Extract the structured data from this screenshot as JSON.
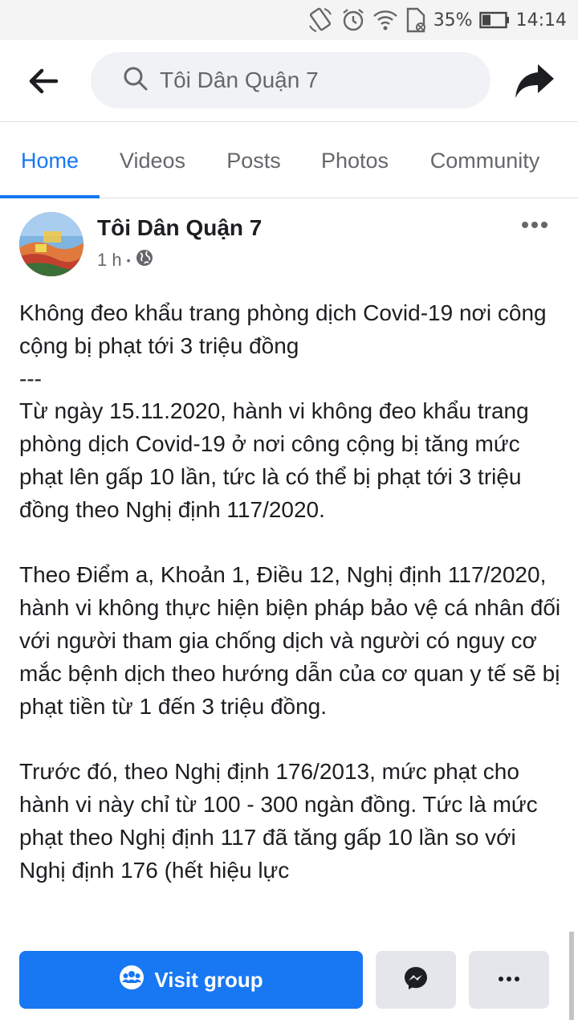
{
  "status_bar": {
    "battery": "35%",
    "time": "14:14",
    "icons": [
      "rotate-icon",
      "alarm-icon",
      "wifi-icon",
      "sim-icon",
      "battery-icon"
    ]
  },
  "nav": {
    "search_text": "Tôi Dân Quận 7",
    "icons": [
      "back-arrow-icon",
      "search-icon",
      "share-icon"
    ]
  },
  "tabs": [
    {
      "label": "Home",
      "active": true
    },
    {
      "label": "Videos",
      "active": false
    },
    {
      "label": "Posts",
      "active": false
    },
    {
      "label": "Photos",
      "active": false
    },
    {
      "label": "Community",
      "active": false
    }
  ],
  "post": {
    "author": "Tôi Dân Quận 7",
    "time": "1 h",
    "separator": "•",
    "privacy_icon": "globe-icon",
    "paragraphs": [
      "Không đeo khẩu trang phòng dịch Covid-19 nơi công cộng bị phạt tới 3 triệu đồng\n---\nTừ ngày 15.11.2020, hành vi không đeo khẩu trang phòng dịch Covid-19 ở nơi công cộng bị tăng mức phạt lên gấp 10 lần, tức là có thể bị phạt tới 3 triệu đồng theo Nghị định 117/2020.",
      "Theo Điểm a, Khoản 1, Điều 12, Nghị định 117/2020, hành vi không thực hiện biện pháp bảo vệ cá nhân đối với người tham gia chống dịch và người có nguy cơ mắc bệnh dịch theo hướng dẫn của cơ quan y tế sẽ bị phạt tiền từ 1 đến 3 triệu đồng.",
      "Trước đó, theo Nghị định 176/2013, mức phạt cho hành vi này chỉ từ 100 - 300 ngàn đồng. Tức là mức phạt theo Nghị định 117 đã tăng gấp 10 lần so với Nghị định 176 (hết hiệu lực"
    ]
  },
  "actions": {
    "visit_label": "Visit group",
    "visit_icon": "group-icon",
    "messenger_icon": "messenger-icon",
    "more_icon": "more-icon"
  },
  "colors": {
    "accent": "#1877f2",
    "button_gray": "#e4e6eb",
    "text_secondary": "#65676b"
  }
}
